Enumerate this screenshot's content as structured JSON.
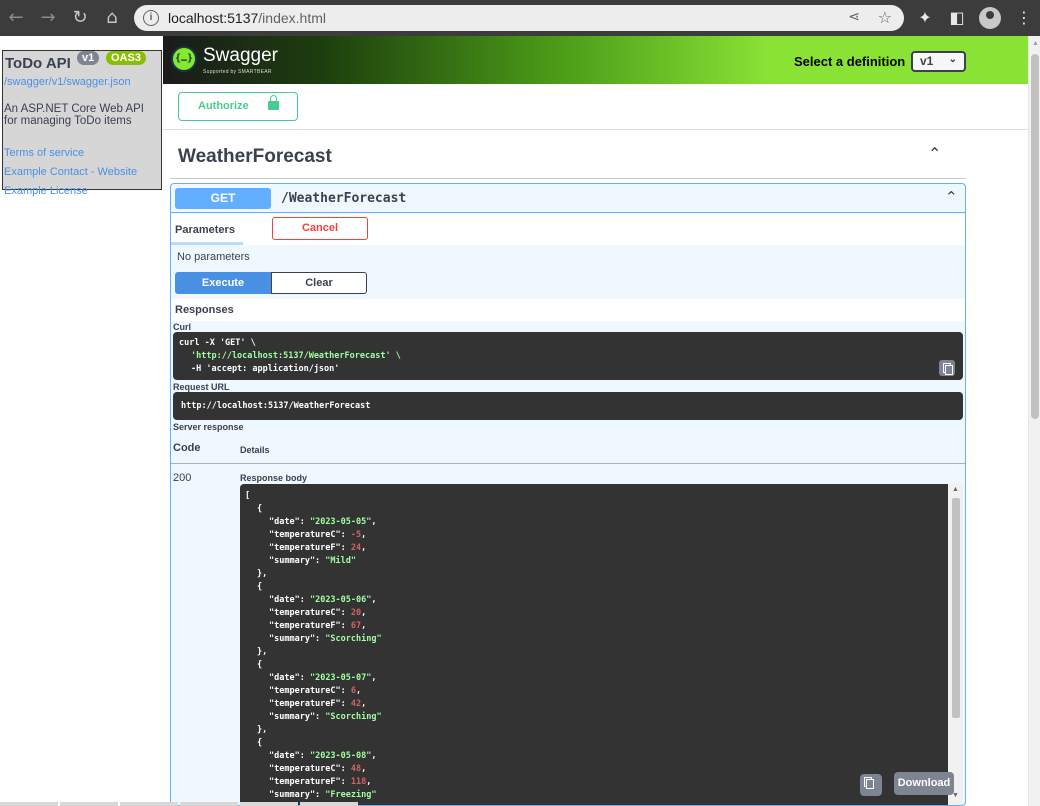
{
  "browser": {
    "url_host": "localhost:5137",
    "url_path": "/index.html",
    "icons": [
      "back-icon",
      "forward-icon",
      "reload-icon",
      "home-icon",
      "info-icon",
      "share-icon",
      "star-icon",
      "extensions-icon",
      "sidepanel-icon",
      "profile-icon",
      "menu-icon"
    ]
  },
  "info": {
    "title": "ToDo API",
    "version_badge": "v1",
    "oas_badge": "OAS3",
    "json_link": "/swagger/v1/swagger.json",
    "description": "An ASP.NET Core Web API for managing ToDo items",
    "terms": "Terms of service",
    "contact": "Example Contact - Website",
    "license": "Example License"
  },
  "topbar": {
    "logo_text": "Swagger",
    "logo_sub": "Supported by SMARTBEAR",
    "logo_glyph": "{…}",
    "definition_label": "Select a definition",
    "definition_value": "v1"
  },
  "authorize_label": "Authorize",
  "section": {
    "title": "WeatherForecast"
  },
  "operation": {
    "method": "GET",
    "path": "/WeatherForecast",
    "parameters_tab": "Parameters",
    "cancel_label": "Cancel",
    "no_params": "No parameters",
    "execute_label": "Execute",
    "clear_label": "Clear",
    "responses_label": "Responses",
    "curl_label": "Curl",
    "curl_lines": [
      "curl -X 'GET' \\",
      "'http://localhost:5137/WeatherForecast' \\",
      "-H 'accept: application/json'"
    ],
    "request_url_label": "Request URL",
    "request_url": "http://localhost:5137/WeatherForecast",
    "server_response_label": "Server response",
    "code_header": "Code",
    "details_header": "Details",
    "response_code": "200",
    "response_body_label": "Response body",
    "download_label": "Download",
    "forecasts": [
      {
        "date": "2023-05-05",
        "temperatureC": "-5",
        "temperatureF": "24",
        "summary": "Mild"
      },
      {
        "date": "2023-05-06",
        "temperatureC": "20",
        "temperatureF": "67",
        "summary": "Scorching"
      },
      {
        "date": "2023-05-07",
        "temperatureC": "6",
        "temperatureF": "42",
        "summary": "Scorching"
      },
      {
        "date": "2023-05-08",
        "temperatureC": "48",
        "temperatureF": "118",
        "summary": "Freezing"
      }
    ]
  },
  "colors": {
    "get": "#61affe",
    "execute": "#4990e2",
    "cancel": "#f93e3e",
    "authorize": "#49cc90",
    "string": "#a2fca2",
    "number": "#d36363"
  }
}
